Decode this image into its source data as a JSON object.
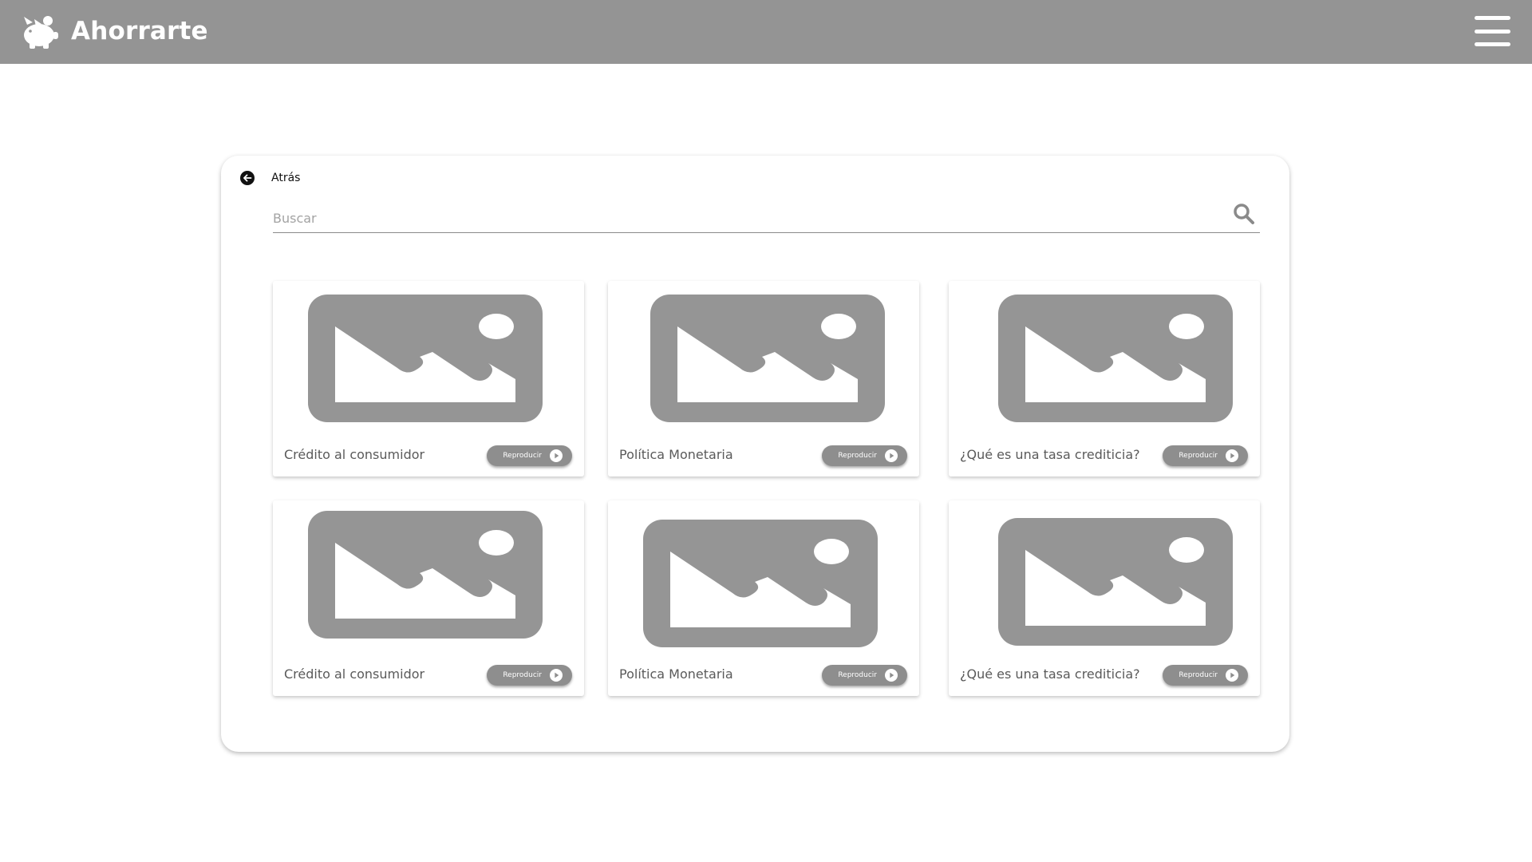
{
  "header": {
    "brand_name": "Ahorrarte",
    "background_color": "#949494",
    "logo_icon": "piggy-bank-icon",
    "menu_icon": "hamburger-menu-icon"
  },
  "back": {
    "label": "Atrás",
    "icon": "arrow-left-circle-icon"
  },
  "search": {
    "placeholder": "Buscar",
    "value": "",
    "icon": "search-icon"
  },
  "videos": [
    {
      "title": "Crédito al consumidor",
      "button_label": "Reproducir",
      "thumbnail_icon": "image-placeholder-icon"
    },
    {
      "title": "Política Monetaria",
      "button_label": "Reproducir",
      "thumbnail_icon": "image-placeholder-icon"
    },
    {
      "title": "¿Qué es una tasa crediticia?",
      "button_label": "Reproducir",
      "thumbnail_icon": "image-placeholder-icon"
    },
    {
      "title": "Crédito al consumidor",
      "button_label": "Reproducir",
      "thumbnail_icon": "image-placeholder-icon"
    },
    {
      "title": "Política Monetaria",
      "button_label": "Reproducir",
      "thumbnail_icon": "image-placeholder-icon"
    },
    {
      "title": "¿Qué es una tasa crediticia?",
      "button_label": "Reproducir",
      "thumbnail_icon": "image-placeholder-icon"
    }
  ]
}
